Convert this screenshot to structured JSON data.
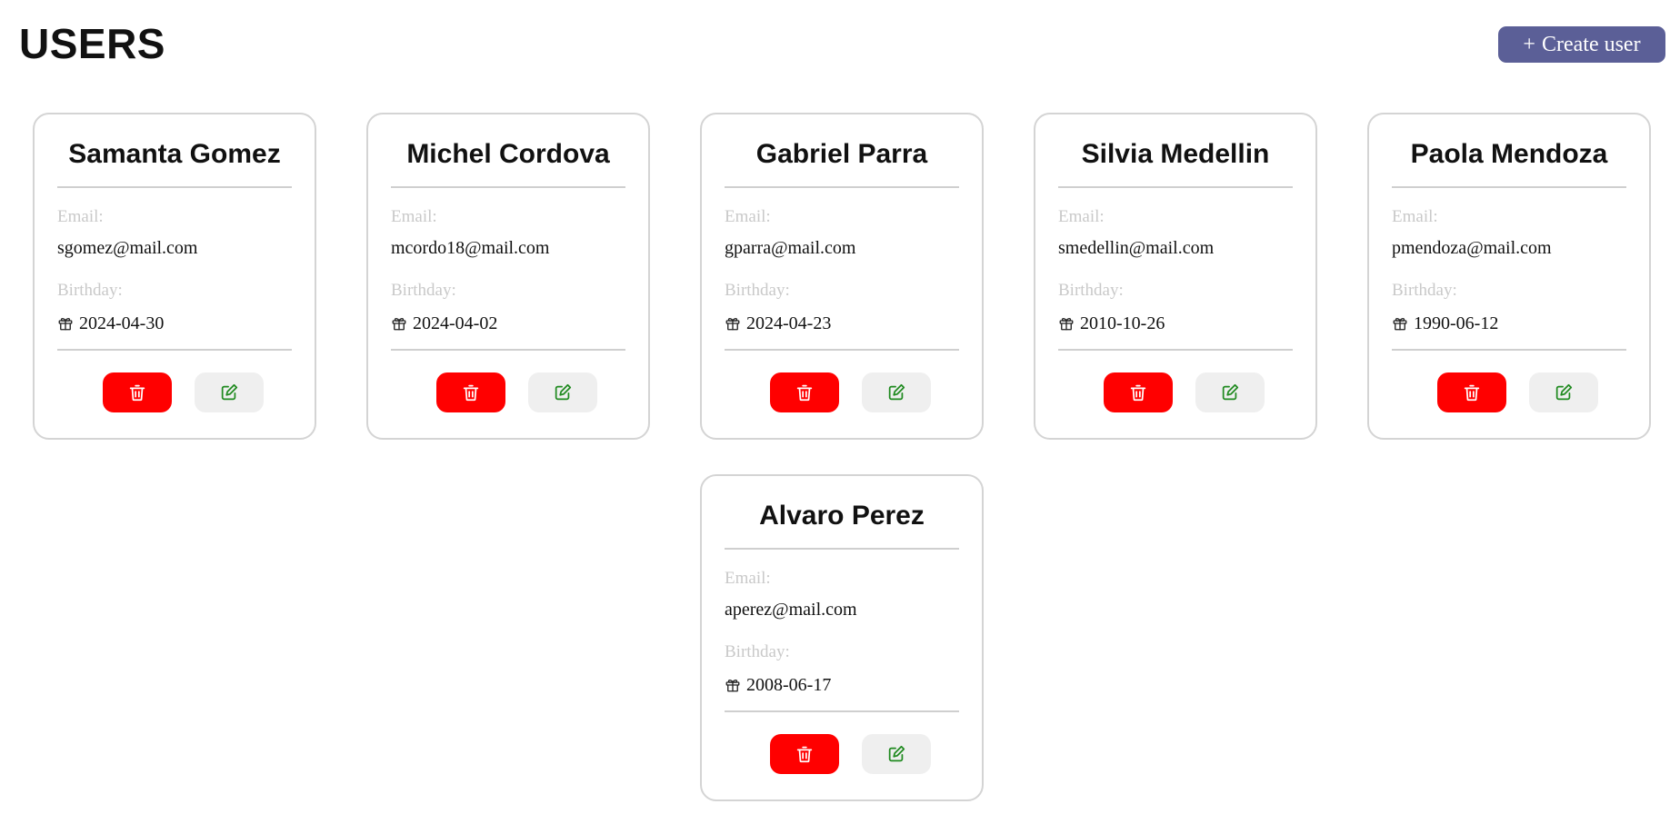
{
  "header": {
    "title": "USERS",
    "create_plus": "+",
    "create_label": "Create user"
  },
  "labels": {
    "email": "Email:",
    "birthday": "Birthday:"
  },
  "icons": {
    "birthday": "gift-icon",
    "delete": "trash-icon",
    "edit": "edit-icon"
  },
  "colors": {
    "create_button": "#5b5f97",
    "delete_button": "#ff0000",
    "edit_button_bg": "#efefef",
    "edit_icon": "#1f8a1f",
    "label_text": "#c9c9c9",
    "card_border": "#d4d4d4"
  },
  "users": [
    {
      "name": "Samanta Gomez",
      "email": "sgomez@mail.com",
      "birthday": "2024-04-30"
    },
    {
      "name": "Michel Cordova",
      "email": "mcordo18@mail.com",
      "birthday": "2024-04-02"
    },
    {
      "name": "Gabriel Parra",
      "email": "gparra@mail.com",
      "birthday": "2024-04-23"
    },
    {
      "name": "Silvia Medellin",
      "email": "smedellin@mail.com",
      "birthday": "2010-10-26"
    },
    {
      "name": "Paola Mendoza",
      "email": "pmendoza@mail.com",
      "birthday": "1990-06-12"
    },
    {
      "name": "Alvaro Perez",
      "email": "aperez@mail.com",
      "birthday": "2008-06-17"
    }
  ]
}
